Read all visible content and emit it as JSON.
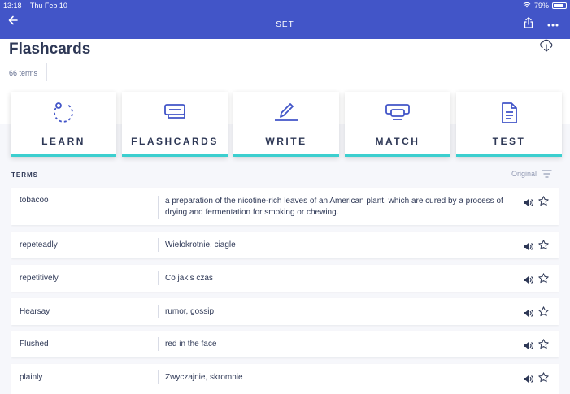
{
  "status": {
    "time": "13:18",
    "date": "Thu Feb 10",
    "battery": "79%"
  },
  "topbar": {
    "title": "SET",
    "back_icon": "arrow-left-icon",
    "share_icon": "share-icon",
    "more_icon": "more-icon"
  },
  "header": {
    "title": "Flashcards",
    "term_count": "66 terms",
    "download_icon": "cloud-download-icon"
  },
  "modes": [
    {
      "label": "LEARN",
      "icon": "learn-icon"
    },
    {
      "label": "FLASHCARDS",
      "icon": "flashcards-icon"
    },
    {
      "label": "WRITE",
      "icon": "write-icon"
    },
    {
      "label": "MATCH",
      "icon": "match-icon"
    },
    {
      "label": "TEST",
      "icon": "test-icon"
    }
  ],
  "terms_section": {
    "label": "TERMS",
    "sort_label": "Original",
    "sort_icon": "filter-icon"
  },
  "terms": [
    {
      "term": "tobacoo",
      "definition": "a preparation of the nicotine-rich leaves of an American plant, which are cured by a process of drying and fermentation for smoking or chewing."
    },
    {
      "term": "repeteadly",
      "definition": "Wielokrotnie, ciagle"
    },
    {
      "term": "repetitively",
      "definition": "Co jakis czas"
    },
    {
      "term": "Hearsay",
      "definition": "rumor, gossip"
    },
    {
      "term": "Flushed",
      "definition": "red in the face"
    },
    {
      "term": "plainly",
      "definition": "Zwyczajnie, skromnie"
    }
  ],
  "colors": {
    "bar": "#4255c8",
    "accent": "#3ccfcf",
    "text": "#2e3856"
  }
}
